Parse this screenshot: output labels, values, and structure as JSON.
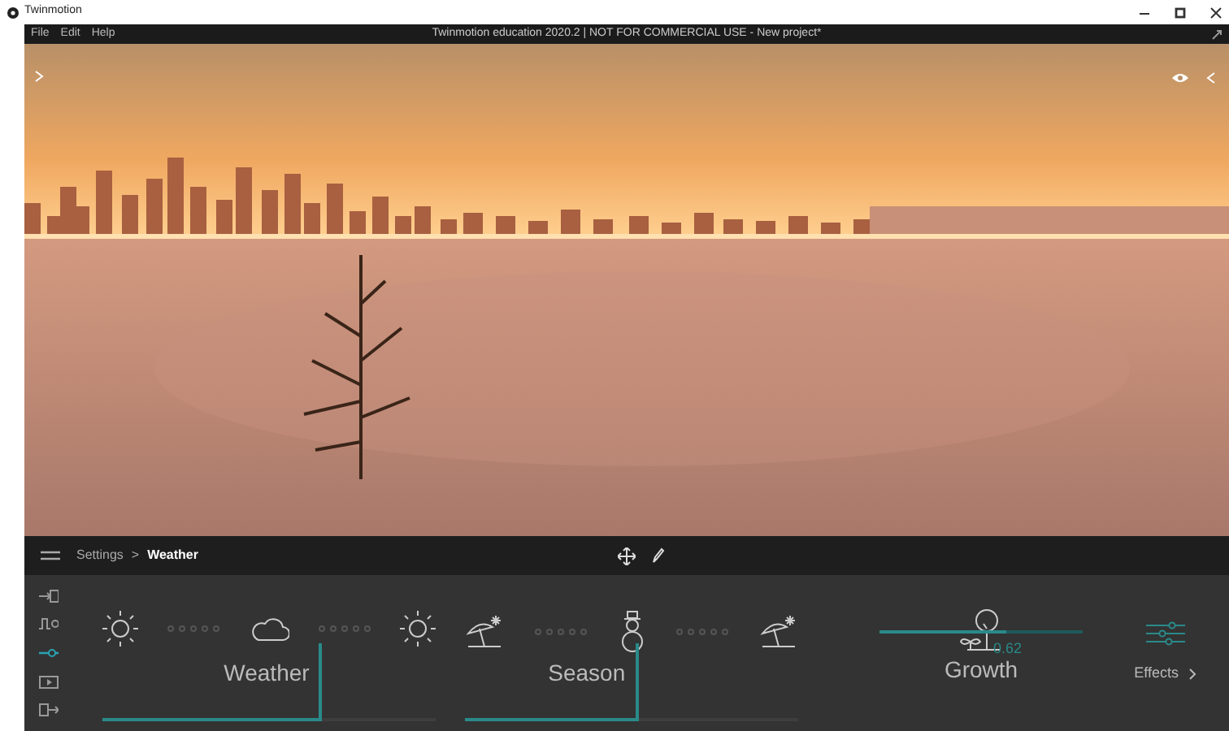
{
  "window": {
    "title": "Twinmotion"
  },
  "menu": [
    "File",
    "Edit",
    "Help"
  ],
  "title_text": "Twinmotion education 2020.2 | NOT FOR COMMERCIAL USE - New project*",
  "breadcrumb": [
    "Settings",
    "Weather"
  ],
  "breadcrumb_separator": ">",
  "side_tools": [
    {
      "kind": "import",
      "selected": false
    },
    {
      "kind": "wave",
      "selected": false
    },
    {
      "kind": "slider",
      "selected": true
    },
    {
      "kind": "media",
      "selected": false
    },
    {
      "kind": "export",
      "selected": false
    }
  ],
  "dials": [
    {
      "label": "Weather",
      "level": 0.66,
      "icons": [
        {
          "kind": "sun"
        },
        {
          "kind": "cloud"
        },
        {
          "kind": "sun"
        }
      ]
    },
    {
      "label": "Season",
      "level": 0.52,
      "icons": [
        {
          "kind": "beach"
        },
        {
          "kind": "snowman"
        },
        {
          "kind": "beach"
        }
      ]
    }
  ],
  "growth": {
    "label": "Growth",
    "value": "0.62",
    "level": 0.62
  },
  "effects": {
    "label": "Effects"
  }
}
